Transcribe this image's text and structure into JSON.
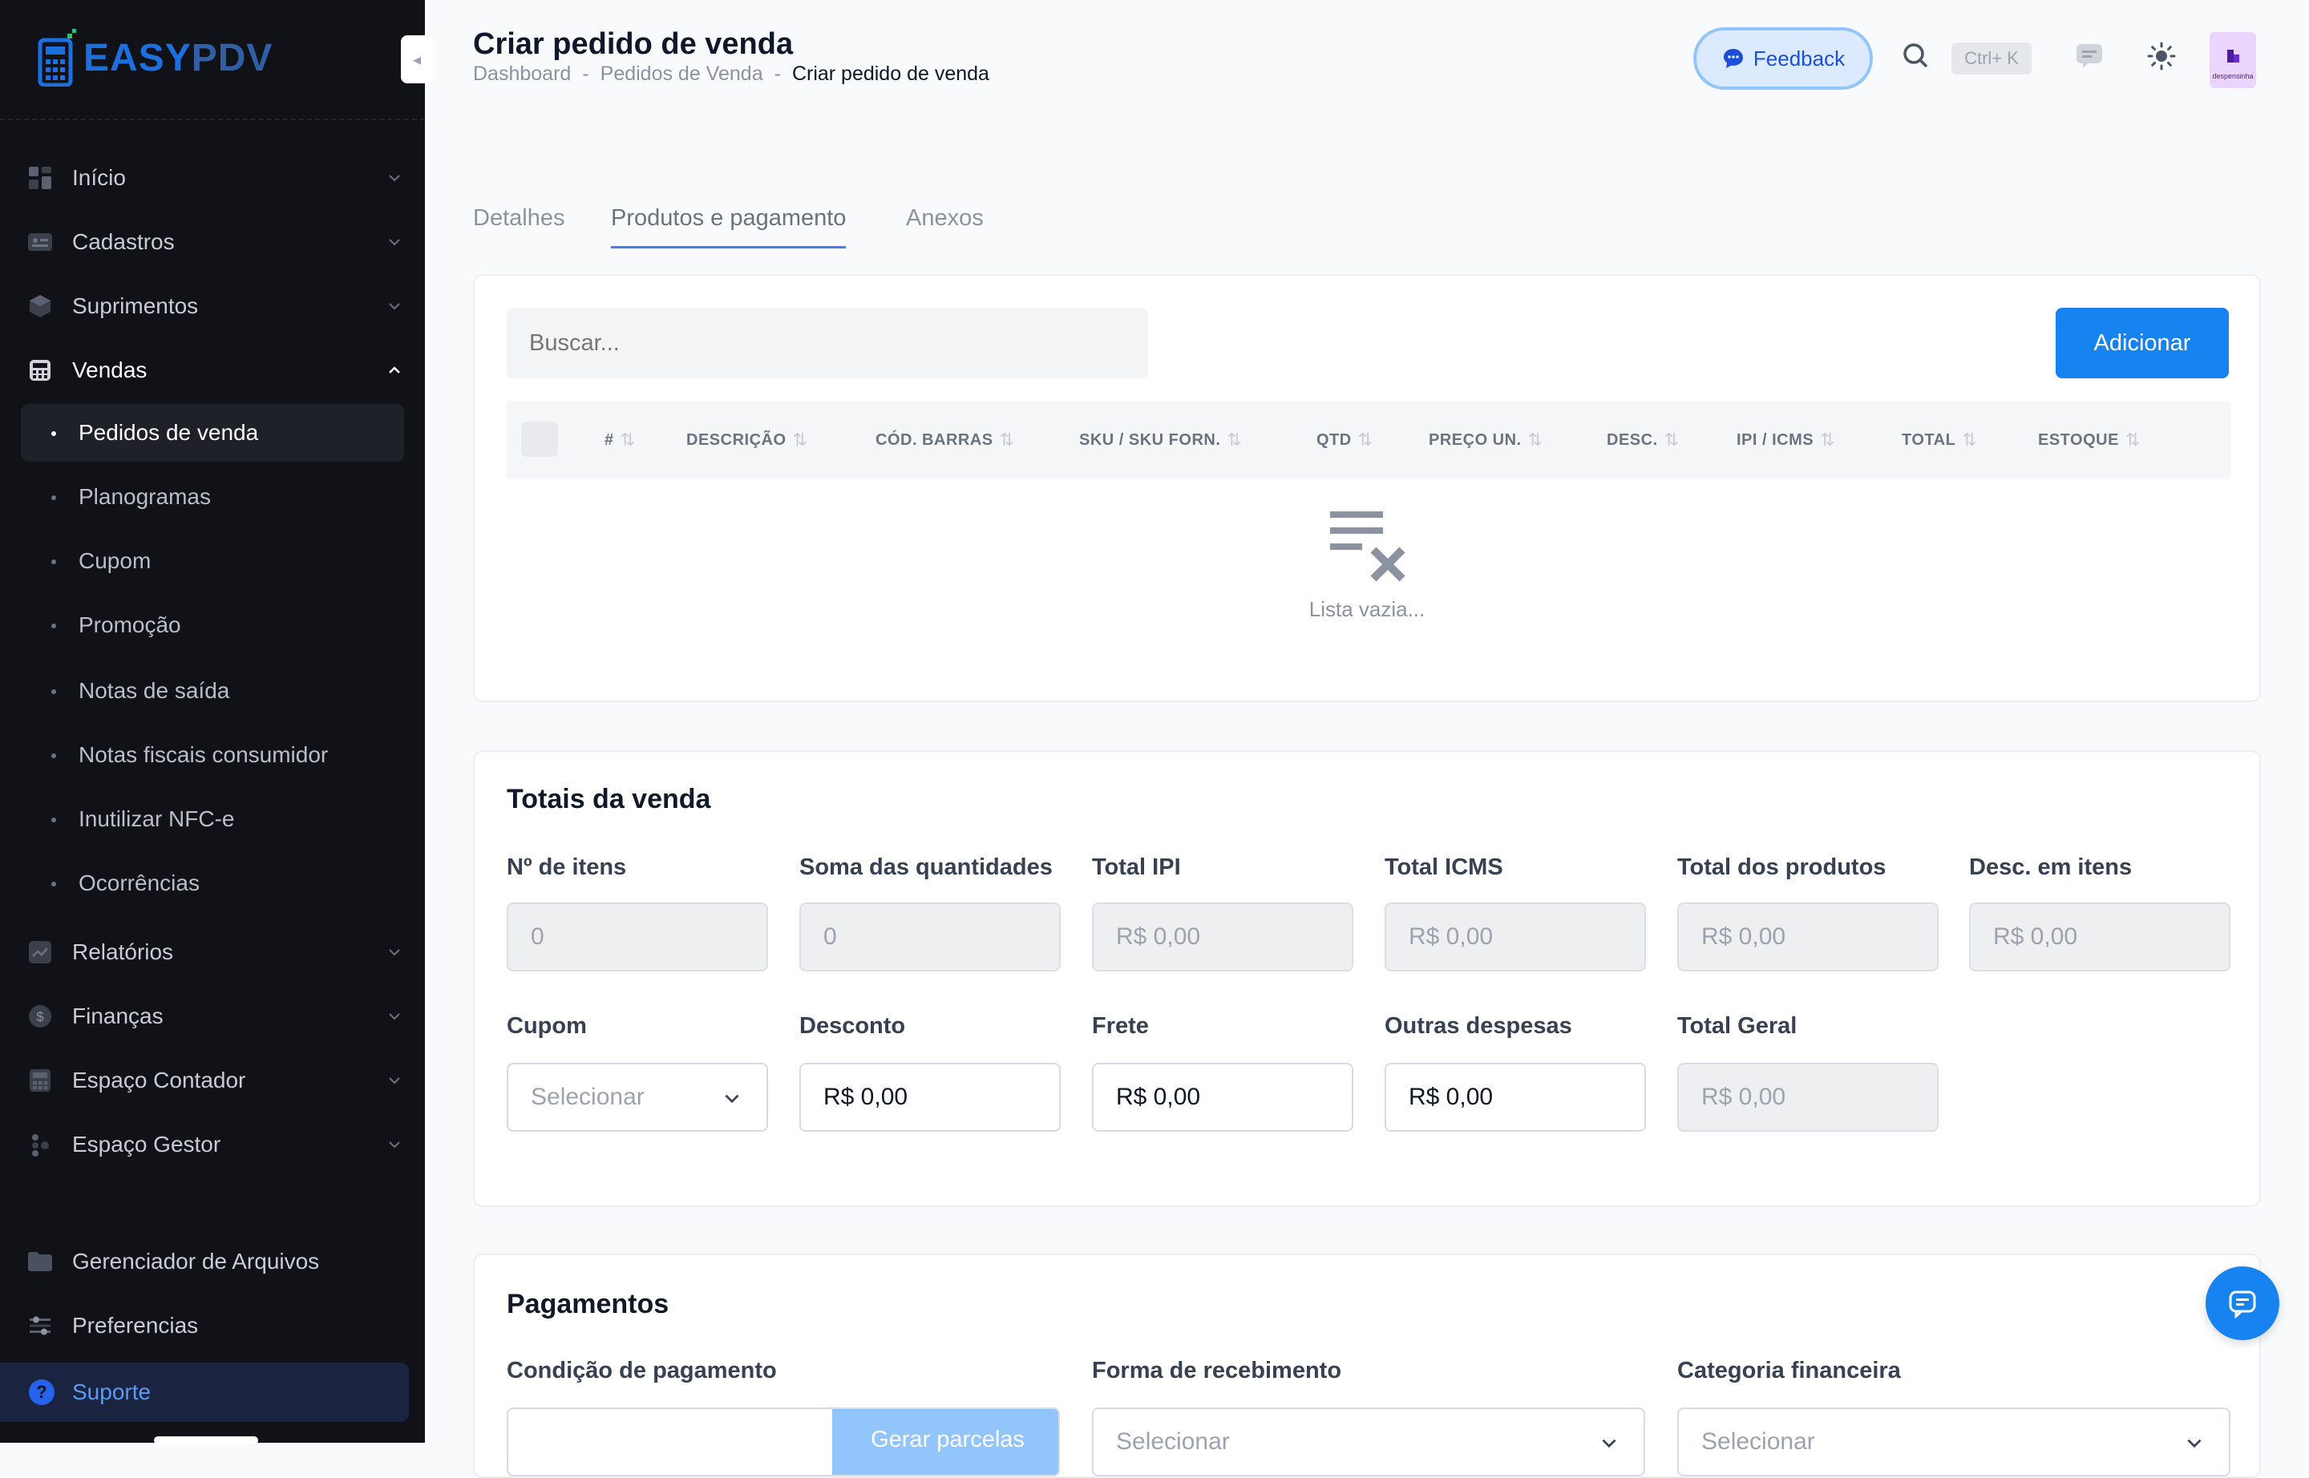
{
  "app": {
    "logo_easy": "EASY",
    "logo_pdv": "PDV"
  },
  "sidebar": {
    "items": [
      {
        "label": "Início",
        "icon": "dashboard-icon"
      },
      {
        "label": "Cadastros",
        "icon": "id-card-icon"
      },
      {
        "label": "Suprimentos",
        "icon": "box-icon"
      },
      {
        "label": "Vendas",
        "icon": "cash-register-icon",
        "expanded": true
      }
    ],
    "vendas_subitems": [
      {
        "label": "Pedidos de venda",
        "active": true
      },
      {
        "label": "Planogramas"
      },
      {
        "label": "Cupom"
      },
      {
        "label": "Promoção"
      },
      {
        "label": "Notas de saída"
      },
      {
        "label": "Notas fiscais consumidor"
      },
      {
        "label": "Inutilizar NFC-e"
      },
      {
        "label": "Ocorrências"
      }
    ],
    "items_after": [
      {
        "label": "Relatórios",
        "icon": "chart-icon"
      },
      {
        "label": "Finanças",
        "icon": "dollar-icon"
      },
      {
        "label": "Espaço Contador",
        "icon": "calculator-icon"
      },
      {
        "label": "Espaço Gestor",
        "icon": "people-icon"
      }
    ],
    "bottom_items": [
      {
        "label": "Gerenciador de Arquivos",
        "icon": "folder-icon"
      },
      {
        "label": "Preferencias",
        "icon": "sliders-icon"
      }
    ],
    "support_label": "Suporte"
  },
  "header": {
    "title": "Criar pedido de venda",
    "breadcrumb": [
      "Dashboard",
      "Pedidos de Venda",
      "Criar pedido de venda"
    ],
    "breadcrumb_sep": "-",
    "feedback_label": "Feedback",
    "shortcut": "Ctrl+ K",
    "avatar_text": "despensinha"
  },
  "tabs": [
    "Detalhes",
    "Produtos e pagamento",
    "Anexos"
  ],
  "active_tab": "Produtos e pagamento",
  "products": {
    "search_placeholder": "Buscar...",
    "add_label": "Adicionar",
    "columns": [
      "#",
      "DESCRIÇÃO",
      "CÓD. BARRAS",
      "SKU / SKU FORN.",
      "QTD",
      "PREÇO UN.",
      "DESC.",
      "IPI / ICMS",
      "TOTAL",
      "ESTOQUE"
    ],
    "rows": [],
    "empty_text": "Lista vazia..."
  },
  "totals": {
    "title": "Totais da venda",
    "row1": [
      {
        "label": "Nº de itens",
        "value": "0"
      },
      {
        "label": "Soma das quantidades",
        "value": "0"
      },
      {
        "label": "Total IPI",
        "value": "R$ 0,00"
      },
      {
        "label": "Total ICMS",
        "value": "R$ 0,00"
      },
      {
        "label": "Total dos produtos",
        "value": "R$ 0,00"
      },
      {
        "label": "Desc. em itens",
        "value": "R$ 0,00"
      }
    ],
    "row2": [
      {
        "label": "Cupom",
        "value": "Selecionar"
      },
      {
        "label": "Desconto",
        "value": "R$ 0,00"
      },
      {
        "label": "Frete",
        "value": "R$ 0,00"
      },
      {
        "label": "Outras despesas",
        "value": "R$ 0,00"
      },
      {
        "label": "Total Geral",
        "value": "R$ 0,00"
      }
    ]
  },
  "payments": {
    "title": "Pagamentos",
    "condition_label": "Condição de pagamento",
    "generate_label": "Gerar parcelas",
    "method_label": "Forma de recebimento",
    "method_value": "Selecionar",
    "category_label": "Categoria financeira",
    "category_value": "Selecionar"
  },
  "colors": {
    "sidebar_bg": "#111217",
    "accent": "#1683f0",
    "page_bg": "#f9fafb"
  }
}
